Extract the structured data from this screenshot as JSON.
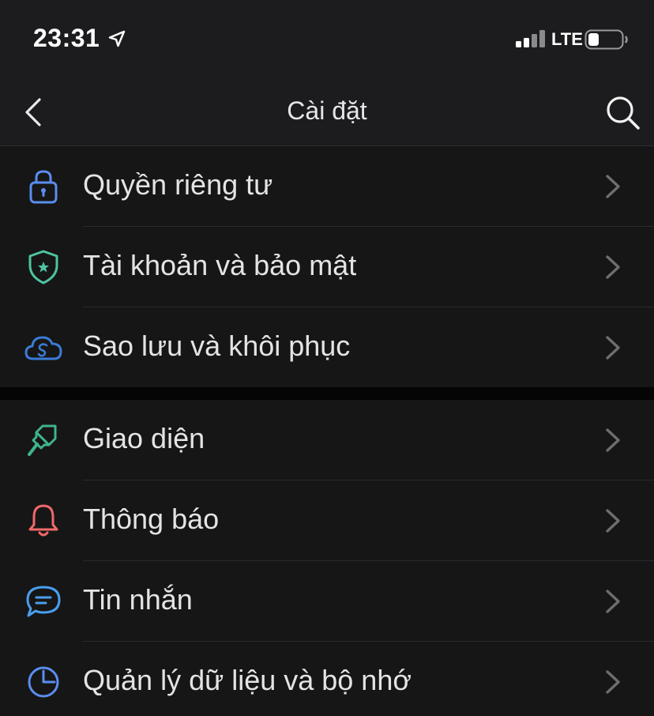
{
  "status_bar": {
    "time": "23:31",
    "network": "LTE",
    "location_icon": "location-arrow-icon",
    "signal_icon": "signal-bars-icon",
    "battery_icon": "battery-icon"
  },
  "nav": {
    "title": "Cài đặt",
    "back_icon": "chevron-left-icon",
    "search_icon": "search-icon"
  },
  "groups": [
    {
      "items": [
        {
          "label": "Quyền riêng tư",
          "icon": "lock-icon",
          "icon_color": "#5b8def"
        },
        {
          "label": "Tài khoản và bảo mật",
          "icon": "shield-star-icon",
          "icon_color": "#4fc3a1"
        },
        {
          "label": "Sao lưu và khôi phục",
          "icon": "cloud-sync-icon",
          "icon_color": "#3a7bd5"
        }
      ]
    },
    {
      "items": [
        {
          "label": "Giao diện",
          "icon": "paint-brush-icon",
          "icon_color": "#3fb48a"
        },
        {
          "label": "Thông báo",
          "icon": "bell-icon",
          "icon_color": "#f0696a"
        },
        {
          "label": "Tin nhắn",
          "icon": "chat-bubble-icon",
          "icon_color": "#4a9ef0"
        },
        {
          "label": "Quản lý dữ liệu và bộ nhớ",
          "icon": "pie-clock-icon",
          "icon_color": "#5b8def"
        }
      ]
    }
  ],
  "colors": {
    "background": "#1c1c1e",
    "group_background": "#161616",
    "chevron": "#6e6e72"
  }
}
